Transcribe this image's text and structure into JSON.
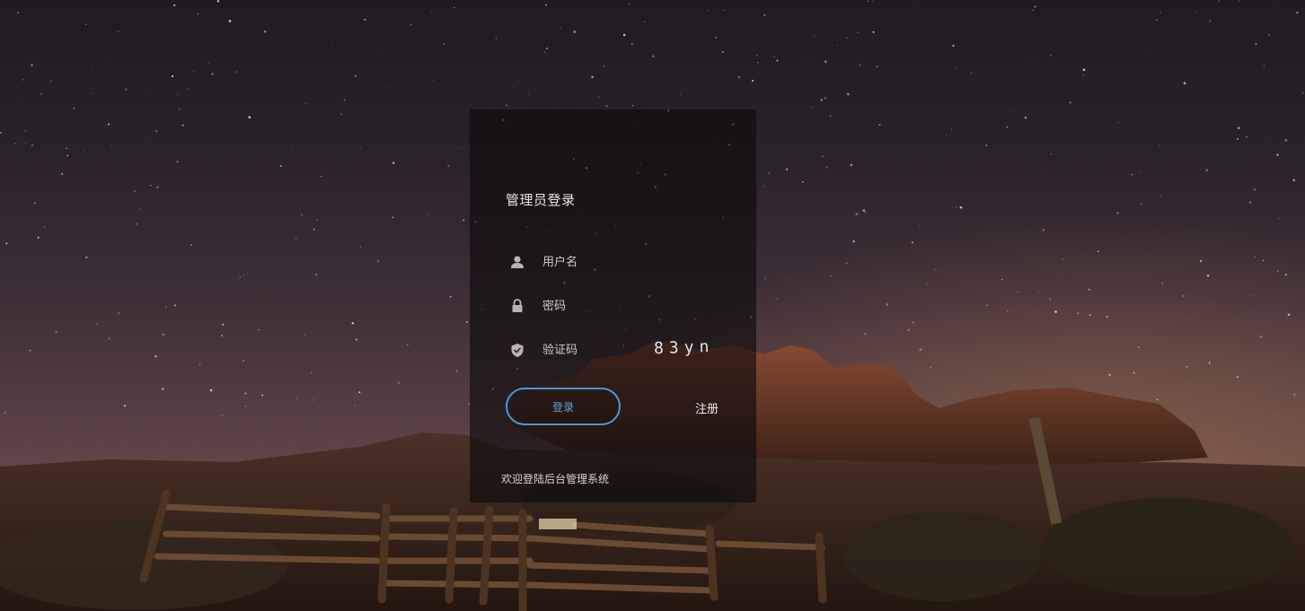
{
  "login": {
    "title": "管理员登录",
    "username_placeholder": "用户名",
    "password_placeholder": "密码",
    "captcha_placeholder": "验证码",
    "captcha_code": "83yn",
    "login_button": "登录",
    "register_link": "注册",
    "welcome_text": "欢迎登陆后台管理系统"
  },
  "icons": {
    "username": "user-icon",
    "password": "lock-icon",
    "captcha": "shield-check-icon"
  },
  "colors": {
    "accent": "#4a97d4",
    "panel_bg": "rgba(12,10,12,0.62)",
    "text": "#e9e6ea"
  }
}
